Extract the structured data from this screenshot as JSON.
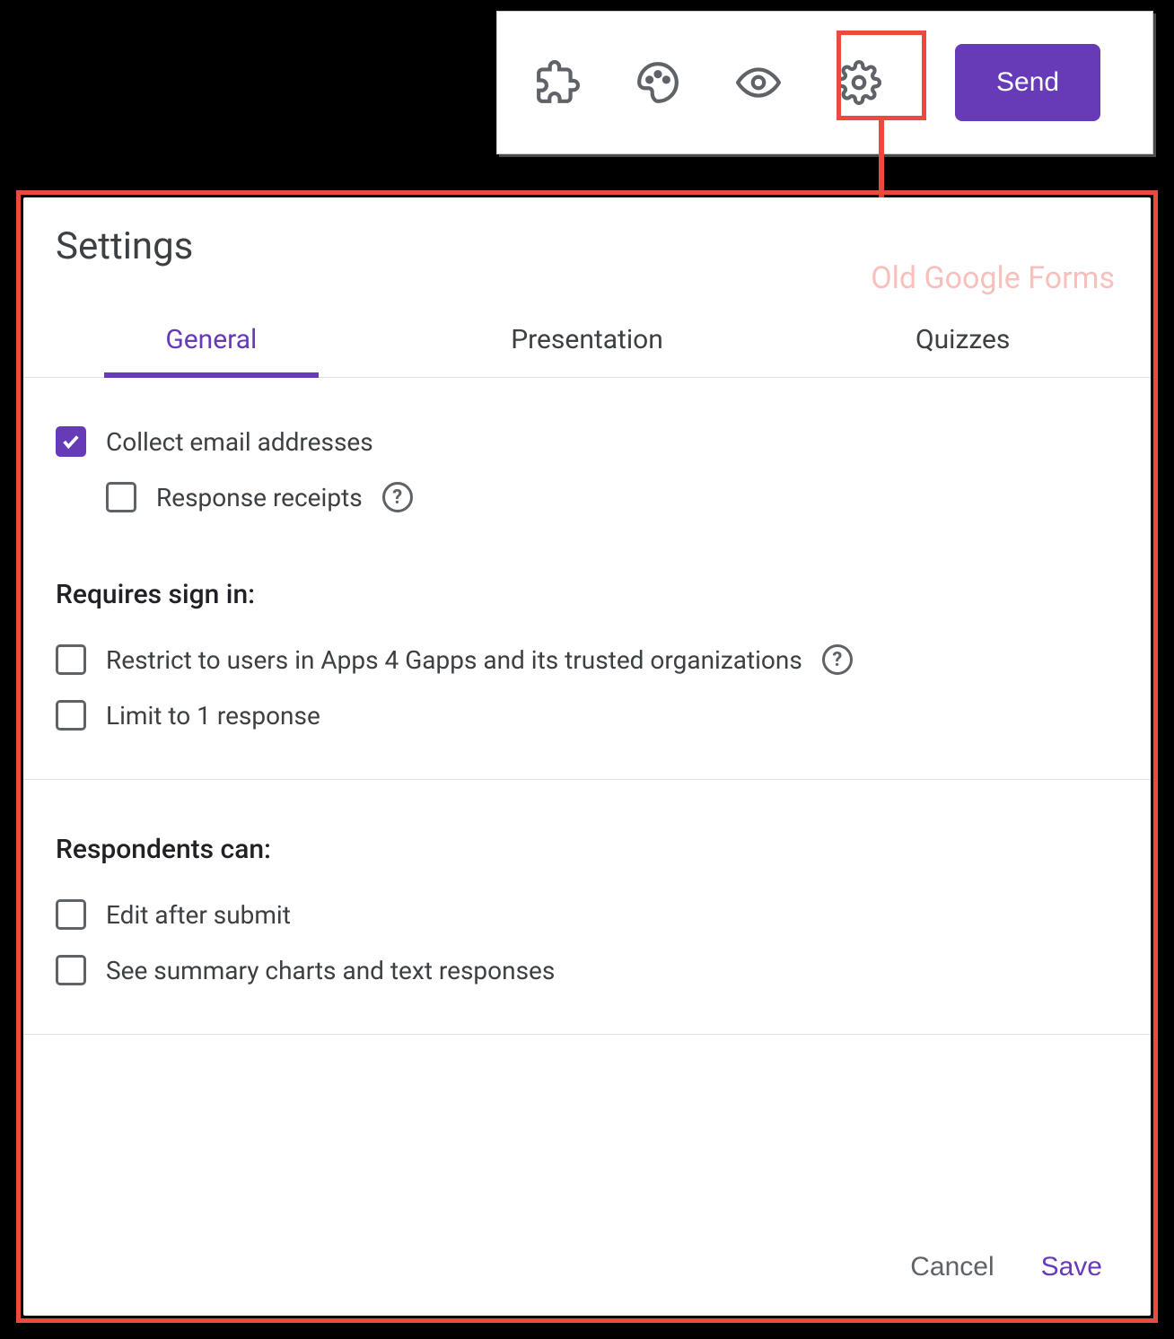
{
  "toolbar": {
    "send_label": "Send"
  },
  "annotation": {
    "watermark": "Old Google Forms"
  },
  "dialog": {
    "title": "Settings",
    "tabs": {
      "general": "General",
      "presentation": "Presentation",
      "quizzes": "Quizzes",
      "active": "general"
    },
    "general": {
      "collect_email": {
        "label": "Collect email addresses",
        "checked": true
      },
      "response_receipts": {
        "label": "Response receipts",
        "checked": false
      },
      "section_signin": "Requires sign in:",
      "restrict": {
        "label": "Restrict to users in Apps 4 Gapps and its trusted organizations",
        "checked": false
      },
      "limit_one": {
        "label": "Limit to 1 response",
        "checked": false
      },
      "section_respondents": "Respondents can:",
      "edit_after": {
        "label": "Edit after submit",
        "checked": false
      },
      "see_summary": {
        "label": "See summary charts and text responses",
        "checked": false
      }
    },
    "footer": {
      "cancel": "Cancel",
      "save": "Save"
    }
  }
}
